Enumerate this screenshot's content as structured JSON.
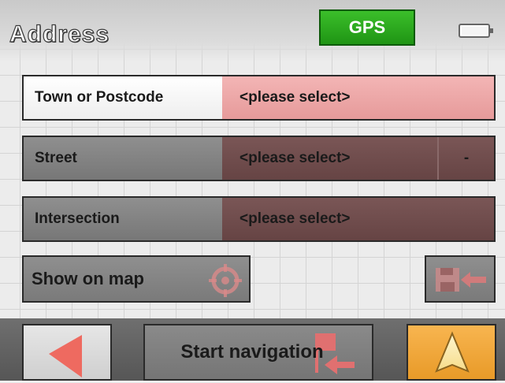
{
  "header": {
    "title": "Address",
    "gps_label": "GPS",
    "gps_color": "#22a018"
  },
  "icons": {
    "battery": "battery-icon",
    "crosshair": "crosshair-target-icon",
    "save_destination": "save-destination-icon",
    "back": "back-arrow-icon",
    "start_flag": "flag-arrow-icon",
    "navigate": "navigation-arrow-icon"
  },
  "fields": [
    {
      "label": "Town or Postcode",
      "value": "<please select>",
      "active": true
    },
    {
      "label": "Street",
      "value": "<please select>",
      "extra": "-",
      "active": false
    },
    {
      "label": "Intersection",
      "value": "<please select>",
      "active": false
    }
  ],
  "buttons": {
    "show_on_map": "Show on map",
    "start_navigation": "Start navigation"
  },
  "colors": {
    "active_value_bg": "#f0aaaa",
    "inactive_value_bg": "#6e4a4a",
    "go_button": "#f4a83a",
    "accent_red": "#ee6a60"
  }
}
